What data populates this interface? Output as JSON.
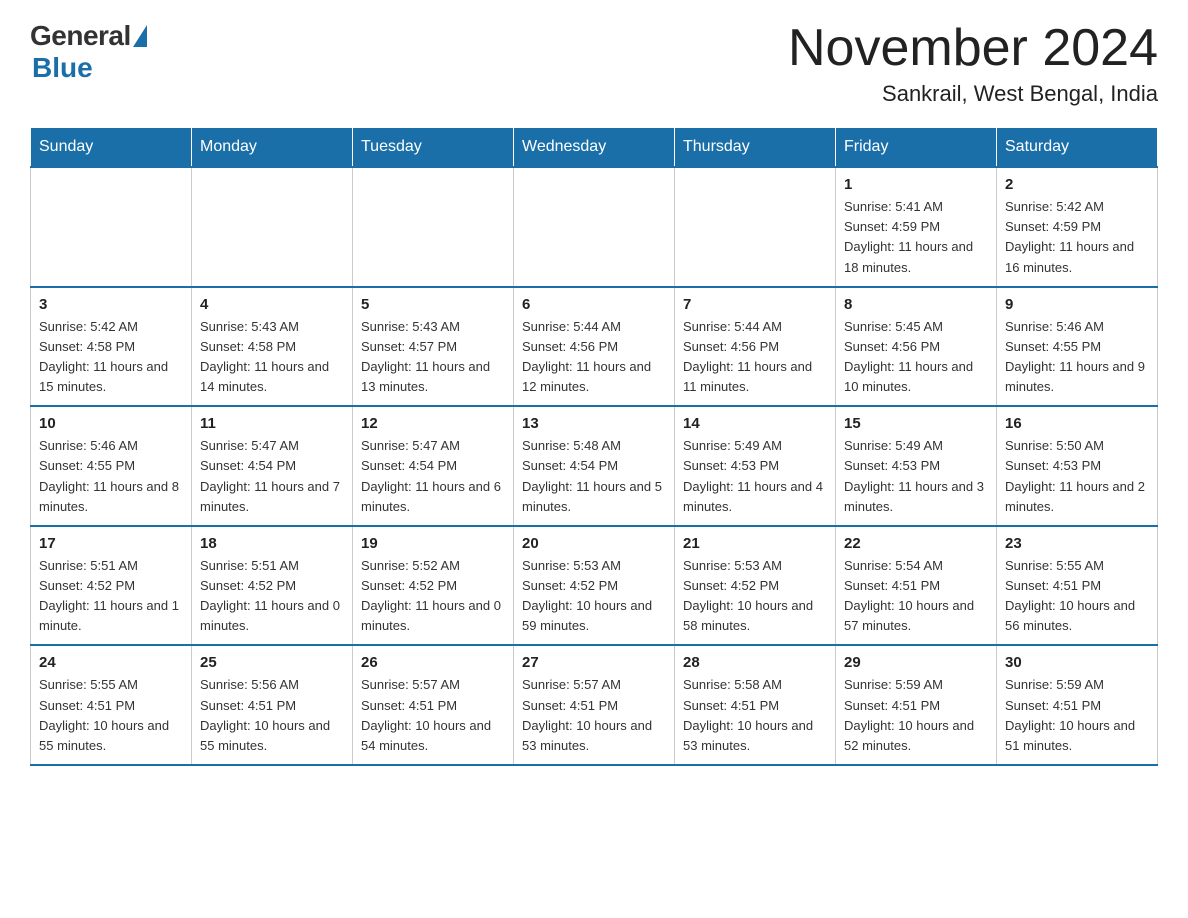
{
  "logo": {
    "general": "General",
    "blue": "Blue"
  },
  "title": {
    "month_year": "November 2024",
    "location": "Sankrail, West Bengal, India"
  },
  "days_of_week": [
    "Sunday",
    "Monday",
    "Tuesday",
    "Wednesday",
    "Thursday",
    "Friday",
    "Saturday"
  ],
  "weeks": [
    [
      {
        "day": "",
        "info": ""
      },
      {
        "day": "",
        "info": ""
      },
      {
        "day": "",
        "info": ""
      },
      {
        "day": "",
        "info": ""
      },
      {
        "day": "",
        "info": ""
      },
      {
        "day": "1",
        "info": "Sunrise: 5:41 AM\nSunset: 4:59 PM\nDaylight: 11 hours and 18 minutes."
      },
      {
        "day": "2",
        "info": "Sunrise: 5:42 AM\nSunset: 4:59 PM\nDaylight: 11 hours and 16 minutes."
      }
    ],
    [
      {
        "day": "3",
        "info": "Sunrise: 5:42 AM\nSunset: 4:58 PM\nDaylight: 11 hours and 15 minutes."
      },
      {
        "day": "4",
        "info": "Sunrise: 5:43 AM\nSunset: 4:58 PM\nDaylight: 11 hours and 14 minutes."
      },
      {
        "day": "5",
        "info": "Sunrise: 5:43 AM\nSunset: 4:57 PM\nDaylight: 11 hours and 13 minutes."
      },
      {
        "day": "6",
        "info": "Sunrise: 5:44 AM\nSunset: 4:56 PM\nDaylight: 11 hours and 12 minutes."
      },
      {
        "day": "7",
        "info": "Sunrise: 5:44 AM\nSunset: 4:56 PM\nDaylight: 11 hours and 11 minutes."
      },
      {
        "day": "8",
        "info": "Sunrise: 5:45 AM\nSunset: 4:56 PM\nDaylight: 11 hours and 10 minutes."
      },
      {
        "day": "9",
        "info": "Sunrise: 5:46 AM\nSunset: 4:55 PM\nDaylight: 11 hours and 9 minutes."
      }
    ],
    [
      {
        "day": "10",
        "info": "Sunrise: 5:46 AM\nSunset: 4:55 PM\nDaylight: 11 hours and 8 minutes."
      },
      {
        "day": "11",
        "info": "Sunrise: 5:47 AM\nSunset: 4:54 PM\nDaylight: 11 hours and 7 minutes."
      },
      {
        "day": "12",
        "info": "Sunrise: 5:47 AM\nSunset: 4:54 PM\nDaylight: 11 hours and 6 minutes."
      },
      {
        "day": "13",
        "info": "Sunrise: 5:48 AM\nSunset: 4:54 PM\nDaylight: 11 hours and 5 minutes."
      },
      {
        "day": "14",
        "info": "Sunrise: 5:49 AM\nSunset: 4:53 PM\nDaylight: 11 hours and 4 minutes."
      },
      {
        "day": "15",
        "info": "Sunrise: 5:49 AM\nSunset: 4:53 PM\nDaylight: 11 hours and 3 minutes."
      },
      {
        "day": "16",
        "info": "Sunrise: 5:50 AM\nSunset: 4:53 PM\nDaylight: 11 hours and 2 minutes."
      }
    ],
    [
      {
        "day": "17",
        "info": "Sunrise: 5:51 AM\nSunset: 4:52 PM\nDaylight: 11 hours and 1 minute."
      },
      {
        "day": "18",
        "info": "Sunrise: 5:51 AM\nSunset: 4:52 PM\nDaylight: 11 hours and 0 minutes."
      },
      {
        "day": "19",
        "info": "Sunrise: 5:52 AM\nSunset: 4:52 PM\nDaylight: 11 hours and 0 minutes."
      },
      {
        "day": "20",
        "info": "Sunrise: 5:53 AM\nSunset: 4:52 PM\nDaylight: 10 hours and 59 minutes."
      },
      {
        "day": "21",
        "info": "Sunrise: 5:53 AM\nSunset: 4:52 PM\nDaylight: 10 hours and 58 minutes."
      },
      {
        "day": "22",
        "info": "Sunrise: 5:54 AM\nSunset: 4:51 PM\nDaylight: 10 hours and 57 minutes."
      },
      {
        "day": "23",
        "info": "Sunrise: 5:55 AM\nSunset: 4:51 PM\nDaylight: 10 hours and 56 minutes."
      }
    ],
    [
      {
        "day": "24",
        "info": "Sunrise: 5:55 AM\nSunset: 4:51 PM\nDaylight: 10 hours and 55 minutes."
      },
      {
        "day": "25",
        "info": "Sunrise: 5:56 AM\nSunset: 4:51 PM\nDaylight: 10 hours and 55 minutes."
      },
      {
        "day": "26",
        "info": "Sunrise: 5:57 AM\nSunset: 4:51 PM\nDaylight: 10 hours and 54 minutes."
      },
      {
        "day": "27",
        "info": "Sunrise: 5:57 AM\nSunset: 4:51 PM\nDaylight: 10 hours and 53 minutes."
      },
      {
        "day": "28",
        "info": "Sunrise: 5:58 AM\nSunset: 4:51 PM\nDaylight: 10 hours and 53 minutes."
      },
      {
        "day": "29",
        "info": "Sunrise: 5:59 AM\nSunset: 4:51 PM\nDaylight: 10 hours and 52 minutes."
      },
      {
        "day": "30",
        "info": "Sunrise: 5:59 AM\nSunset: 4:51 PM\nDaylight: 10 hours and 51 minutes."
      }
    ]
  ]
}
